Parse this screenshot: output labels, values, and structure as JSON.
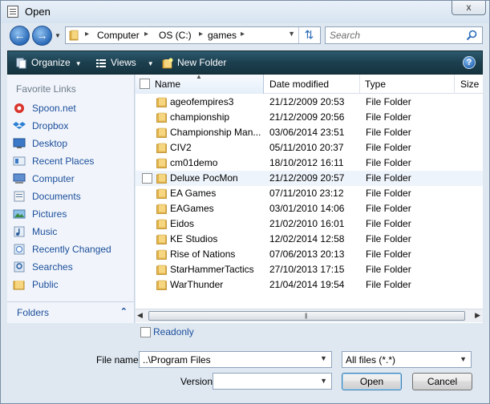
{
  "window": {
    "title": "Open",
    "close_glyph": "x"
  },
  "address": {
    "crumbs": [
      "Computer",
      "OS (C:)",
      "games"
    ],
    "separator": "▸"
  },
  "search": {
    "placeholder": "Search"
  },
  "toolbar": {
    "organize": "Organize",
    "views": "Views",
    "new_folder": "New Folder",
    "help": "?"
  },
  "nav": {
    "section_title": "Favorite Links",
    "items": [
      {
        "label": "Spoon.net",
        "icon": "spoon-icon"
      },
      {
        "label": "Dropbox",
        "icon": "dropbox-icon"
      },
      {
        "label": "Desktop",
        "icon": "desktop-icon"
      },
      {
        "label": "Recent Places",
        "icon": "recent-places-icon"
      },
      {
        "label": "Computer",
        "icon": "computer-icon"
      },
      {
        "label": "Documents",
        "icon": "documents-icon"
      },
      {
        "label": "Pictures",
        "icon": "pictures-icon"
      },
      {
        "label": "Music",
        "icon": "music-icon"
      },
      {
        "label": "Recently Changed",
        "icon": "recently-changed-icon"
      },
      {
        "label": "Searches",
        "icon": "searches-icon"
      },
      {
        "label": "Public",
        "icon": "public-folder-icon"
      }
    ],
    "folders_label": "Folders"
  },
  "columns": {
    "name": "Name",
    "date": "Date modified",
    "type": "Type",
    "size": "Size"
  },
  "files": [
    {
      "name": "ageofempires3",
      "date": "21/12/2009 20:53",
      "type": "File Folder"
    },
    {
      "name": "championship",
      "date": "21/12/2009 20:56",
      "type": "File Folder"
    },
    {
      "name": "Championship Man...",
      "date": "03/06/2014 23:51",
      "type": "File Folder"
    },
    {
      "name": "CIV2",
      "date": "05/11/2010 20:37",
      "type": "File Folder"
    },
    {
      "name": "cm01demo",
      "date": "18/10/2012 16:11",
      "type": "File Folder"
    },
    {
      "name": "Deluxe PocMon",
      "date": "21/12/2009 20:57",
      "type": "File Folder"
    },
    {
      "name": "EA Games",
      "date": "07/11/2010 23:12",
      "type": "File Folder"
    },
    {
      "name": "EAGames",
      "date": "03/01/2010 14:06",
      "type": "File Folder"
    },
    {
      "name": "Eidos",
      "date": "21/02/2010 16:01",
      "type": "File Folder"
    },
    {
      "name": "KE Studios",
      "date": "12/02/2014 12:58",
      "type": "File Folder"
    },
    {
      "name": "Rise of Nations",
      "date": "07/06/2013 20:13",
      "type": "File Folder"
    },
    {
      "name": "StarHammerTactics",
      "date": "27/10/2013 17:15",
      "type": "File Folder"
    },
    {
      "name": "WarThunder",
      "date": "21/04/2014 19:54",
      "type": "File Folder"
    }
  ],
  "hovered_row": 5,
  "bottom": {
    "readonly_label": "Readonly",
    "filename_label": "File name:",
    "filename_value": "..\\Program Files",
    "filter_value": "All files (*.*)",
    "version_label": "Version",
    "version_value": "",
    "open_label": "Open",
    "cancel_label": "Cancel"
  },
  "colors": {
    "toolbar_bg": "#1c3f4f",
    "link_blue": "#1c4e9b",
    "folder_yellow": "#e8b84a"
  }
}
